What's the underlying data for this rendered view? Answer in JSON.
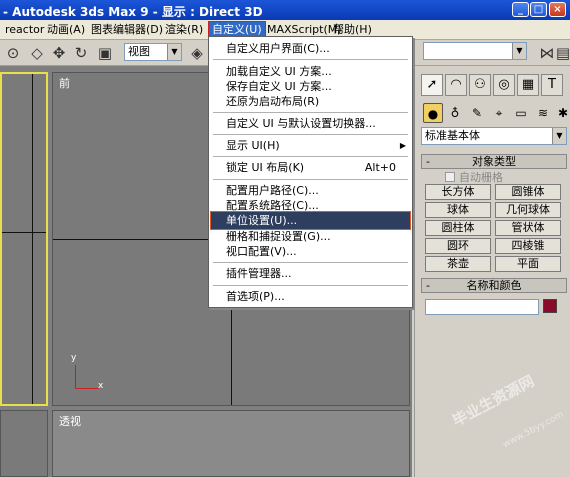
{
  "title": "- Autodesk 3ds Max 9      - 显示 : Direct 3D",
  "window_buttons": {
    "minimize": "_",
    "maximize": "□",
    "close": "×"
  },
  "menubar": [
    {
      "label": "reactor"
    },
    {
      "label": "动画(A)"
    },
    {
      "label": "图表编辑器(D)"
    },
    {
      "label": "渲染(R)"
    },
    {
      "label": "自定义(U)",
      "active": true
    },
    {
      "label": "MAXScript(M)"
    },
    {
      "label": "帮助(H)"
    }
  ],
  "toolbar": {
    "view_combo": "视图",
    "combo_arrow": "▼"
  },
  "viewports": {
    "front_label": "前",
    "persp_label": "透视",
    "axis_y": "y",
    "axis_x": "x"
  },
  "dropdown": {
    "items": [
      {
        "label": "自定义用户界面(C)..."
      },
      {
        "label": "加载自定义 UI 方案..."
      },
      {
        "label": "保存自定义 UI 方案..."
      },
      {
        "label": "还原为启动布局(R)"
      },
      {
        "label": "自定义 UI 与默认设置切换器..."
      },
      {
        "label": "显示 UI(H)",
        "submenu": "▶"
      },
      {
        "label": "锁定 UI 布局(K)",
        "shortcut": "Alt+0"
      },
      {
        "label": "配置用户路径(C)..."
      },
      {
        "label": "配置系统路径(C)..."
      },
      {
        "label": "单位设置(U)...",
        "highlighted": true
      },
      {
        "label": "栅格和捕捉设置(G)..."
      },
      {
        "label": "视口配置(V)..."
      },
      {
        "label": "插件管理器..."
      },
      {
        "label": "首选项(P)..."
      }
    ]
  },
  "panel": {
    "type_combo": "标准基本体",
    "object_type_header": "对象类型",
    "autogrid": "自动栅格",
    "buttons": [
      "长方体",
      "圆锥体",
      "球体",
      "几何球体",
      "圆柱体",
      "管状体",
      "圆环",
      "四棱锥",
      "茶壶",
      "平面"
    ],
    "name_color_header": "名称和颜色",
    "collapse_glyph": "-",
    "color": "#8a0a2a"
  },
  "watermark": "毕业生资源网",
  "watermark_url": "www.5byy.com"
}
